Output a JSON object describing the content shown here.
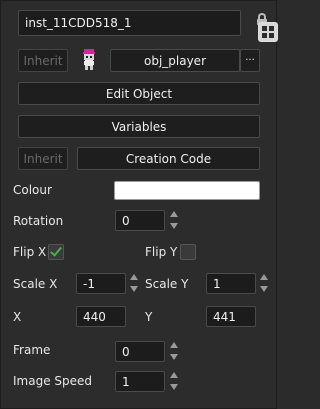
{
  "header": {
    "instance_name": "inst_11CDD518_1",
    "lock_icon": "lock-icon",
    "grid_icon": "grid-icon"
  },
  "object_row": {
    "inherit_label": "Inherit",
    "object_name": "obj_player",
    "more_label": "···",
    "sprite_icon": "player-sprite-icon"
  },
  "buttons": {
    "edit_object": "Edit Object",
    "variables": "Variables",
    "inherit_label": "Inherit",
    "creation_code": "Creation Code"
  },
  "properties": {
    "colour_label": "Colour",
    "colour_value": "#ffffff",
    "rotation_label": "Rotation",
    "rotation_value": "0",
    "flip_x_label": "Flip X",
    "flip_x_checked": true,
    "flip_y_label": "Flip Y",
    "flip_y_checked": false,
    "scale_x_label": "Scale X",
    "scale_x_value": "-1",
    "scale_y_label": "Scale Y",
    "scale_y_value": "1",
    "x_label": "X",
    "x_value": "440",
    "y_label": "Y",
    "y_value": "441",
    "frame_label": "Frame",
    "frame_value": "0",
    "image_speed_label": "Image Speed",
    "image_speed_value": "1"
  },
  "colors": {
    "panel_bg": "#2c2c2c",
    "field_bg": "#1c1c1c",
    "checkbox_tick": "#3fb24a"
  }
}
